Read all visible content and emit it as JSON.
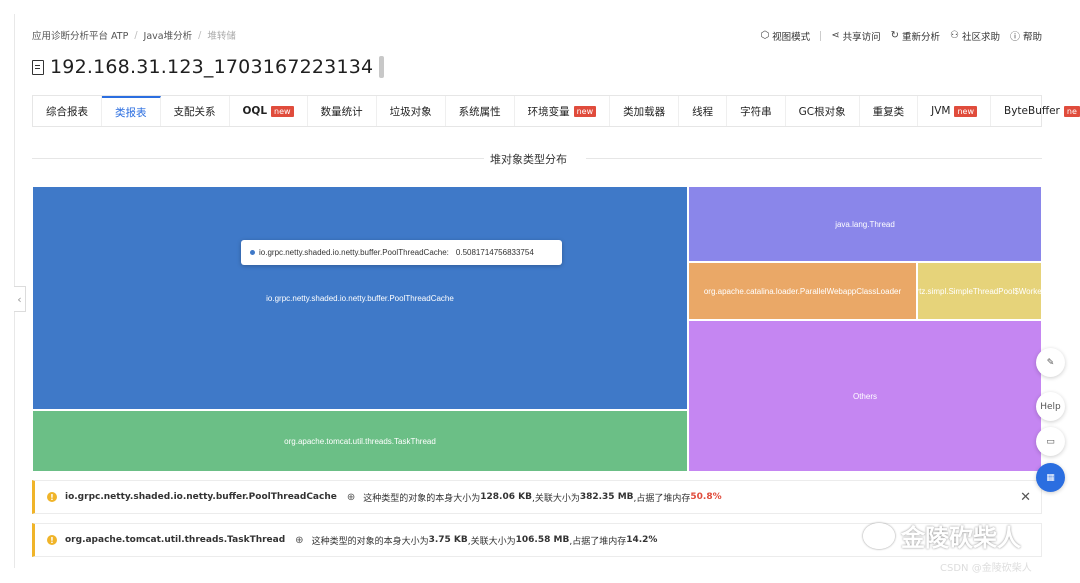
{
  "breadcrumb": [
    "应用诊断分析平台 ATP",
    "Java堆分析",
    "堆转储"
  ],
  "actions": [
    "视图模式",
    "共享访问",
    "重新分析",
    "社区求助",
    "帮助"
  ],
  "title": "192.168.31.123_1703167223134",
  "tabs": [
    {
      "label": "综合报表",
      "new": false,
      "active": false
    },
    {
      "label": "类报表",
      "new": false,
      "active": true
    },
    {
      "label": "支配关系",
      "new": false,
      "active": false
    },
    {
      "label": "OQL",
      "new": true,
      "active": false
    },
    {
      "label": "数量统计",
      "new": false,
      "active": false
    },
    {
      "label": "垃圾对象",
      "new": false,
      "active": false
    },
    {
      "label": "系统属性",
      "new": false,
      "active": false
    },
    {
      "label": "环境变量",
      "new": true,
      "active": false
    },
    {
      "label": "类加载器",
      "new": false,
      "active": false
    },
    {
      "label": "线程",
      "new": false,
      "active": false
    },
    {
      "label": "字符串",
      "new": false,
      "active": false
    },
    {
      "label": "GC根对象",
      "new": false,
      "active": false
    },
    {
      "label": "重复类",
      "new": false,
      "active": false
    },
    {
      "label": "JVM",
      "new": true,
      "active": false
    },
    {
      "label": "ByteBuffer",
      "new": true,
      "active": false
    }
  ],
  "new_badge": "new",
  "new_badge_truncated": "ne",
  "section_title": "堆对象类型分布",
  "treemap": {
    "cells": [
      {
        "label": "io.grpc.netty.shaded.io.netty.buffer.PoolThreadCache",
        "color": "#3f79c8"
      },
      {
        "label": "org.apache.tomcat.util.threads.TaskThread",
        "color": "#6bbf86"
      },
      {
        "label": "java.lang.Thread",
        "color": "#8a86ea"
      },
      {
        "label": "org.apache.catalina.loader.ParallelWebappClassLoader",
        "color": "#eaa867"
      },
      {
        "label": "org.quartz.simpl.SimpleThreadPool$WorkerThread",
        "color": "#e6d37a"
      },
      {
        "label": "Others",
        "color": "#c586f2"
      }
    ],
    "tooltip": {
      "label": "io.grpc.netty.shaded.io.netty.buffer.PoolThreadCache:",
      "value": "0.5081714756833754"
    }
  },
  "alerts": [
    {
      "class": "io.grpc.netty.shaded.io.netty.buffer.PoolThreadCache",
      "t1": "这种类型的对象的本身大小为",
      "self": "128.06 KB",
      "t2": ",关联大小为",
      "retained": "382.35 MB",
      "t3": ",占据了堆内存",
      "pct": "50.8%",
      "pct_red": true
    },
    {
      "class": "org.apache.tomcat.util.threads.TaskThread",
      "t1": "这种类型的对象的本身大小为",
      "self": "3.75 KB",
      "t2": ",关联大小为",
      "retained": "106.58 MB",
      "t3": ",占据了堆内存",
      "pct": "14.2%",
      "pct_red": false
    }
  ],
  "fab_help": "Help",
  "watermark": "金陵砍柴人",
  "csdn": "CSDN @金陵砍柴人"
}
